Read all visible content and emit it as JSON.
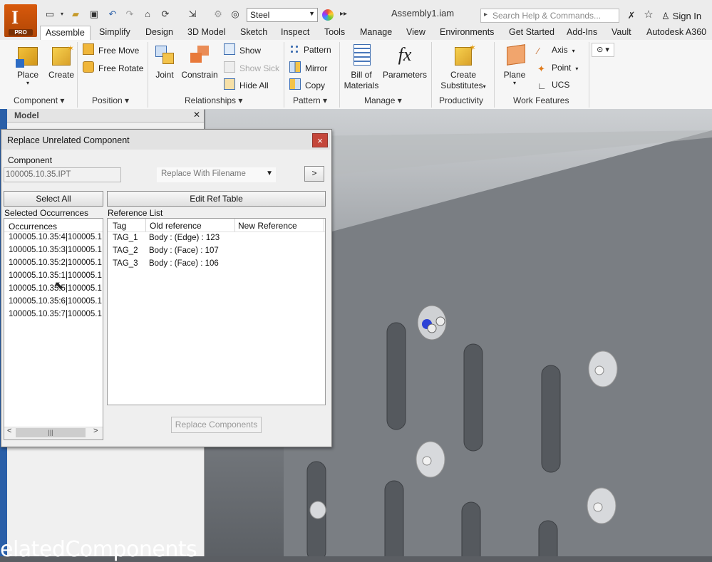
{
  "app": {
    "badge": "PRO",
    "document_title": "Assembly1.iam"
  },
  "quick_access": {
    "material": "Steel"
  },
  "search": {
    "placeholder": "Search Help & Commands..."
  },
  "account": {
    "sign_in": "Sign In"
  },
  "tabs": [
    "Assemble",
    "Simplify",
    "Design",
    "3D Model",
    "Sketch",
    "Inspect",
    "Tools",
    "Manage",
    "View",
    "Environments",
    "Get Started",
    "Add-Ins",
    "Vault",
    "Autodesk A360"
  ],
  "ribbon": {
    "place": "Place",
    "create": "Create",
    "free_move": "Free Move",
    "free_rotate": "Free Rotate",
    "joint": "Joint",
    "constrain": "Constrain",
    "show": "Show",
    "show_sick": "Show Sick",
    "hide_all": "Hide All",
    "pattern": "Pattern",
    "mirror": "Mirror",
    "copy": "Copy",
    "bom_line1": "Bill of",
    "bom_line2": "Materials",
    "parameters": "Parameters",
    "create_subs_line1": "Create",
    "create_subs_line2": "Substitutes",
    "plane": "Plane",
    "axis": "Axis",
    "point": "Point",
    "ucs": "UCS",
    "panels": [
      "Component",
      "Position",
      "Relationships",
      "Pattern",
      "Manage",
      "Productivity",
      "Work Features"
    ]
  },
  "browser": {
    "header": "Model"
  },
  "dialog": {
    "title": "Replace Unrelated Component",
    "component_label": "Component",
    "component_value": "100005.10.35.IPT",
    "replace_with": "Replace With Filename",
    "next": ">",
    "select_all": "Select All",
    "edit_ref_table": "Edit Ref Table",
    "selected_occurrences": "Selected Occurrences",
    "reference_list": "Reference List",
    "occurrences_header": "Occurrences",
    "occurrences": [
      "100005.10.35:4|100005.1",
      "100005.10.35:3|100005.1",
      "100005.10.35:2|100005.1",
      "100005.10.35:1|100005.1",
      "100005.10.35:5|100005.1",
      "100005.10.35:6|100005.1",
      "100005.10.35:7|100005.1"
    ],
    "ref_headers": [
      "Tag",
      "Old reference",
      "New Reference"
    ],
    "refs": [
      {
        "tag": "TAG_1",
        "old": "Body : (Edge) : 123",
        "new": ""
      },
      {
        "tag": "TAG_2",
        "old": "Body : (Face) : 107",
        "new": ""
      },
      {
        "tag": "TAG_3",
        "old": "Body : (Face) : 106",
        "new": ""
      }
    ],
    "replace_components": "Replace Components",
    "close": "×"
  },
  "caption": "elatedComponents"
}
